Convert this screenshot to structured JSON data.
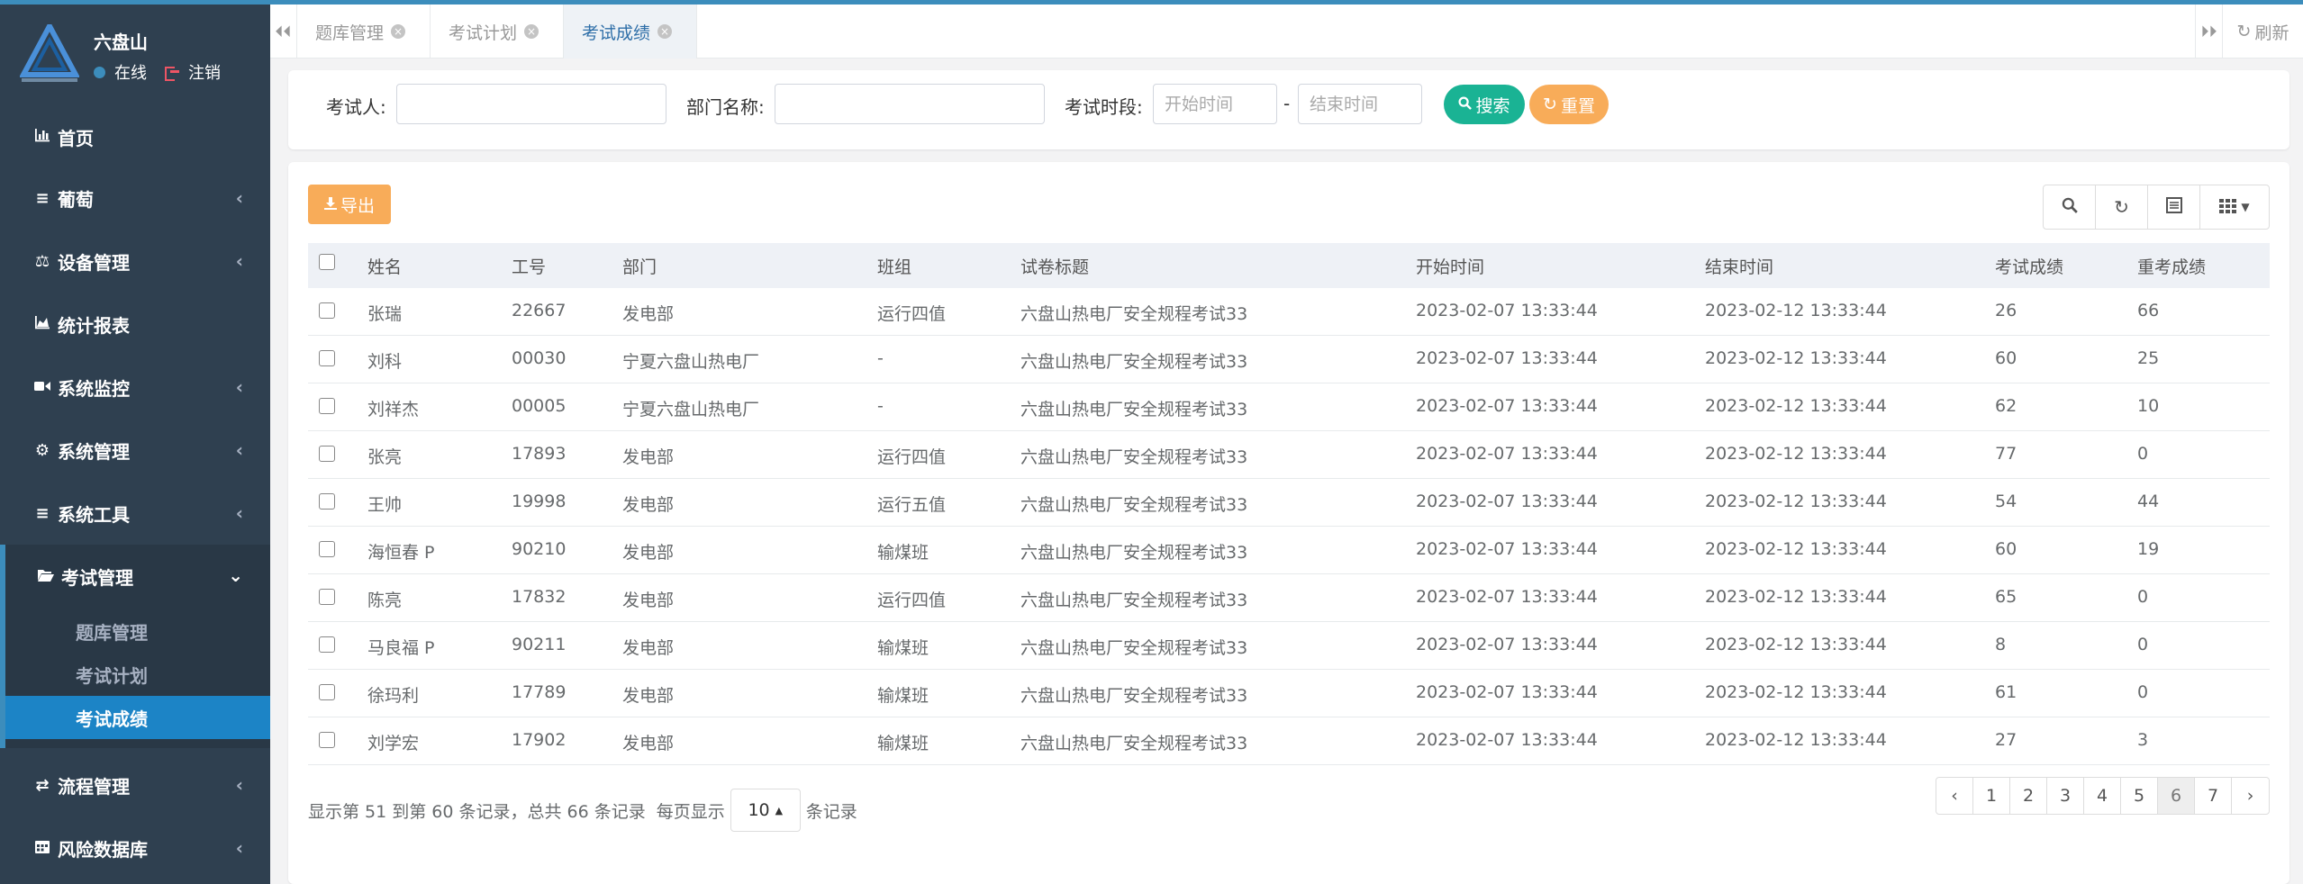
{
  "brand": {
    "user_name": "六盘山",
    "status": "在线",
    "logout": "注销"
  },
  "sidebar": {
    "items": [
      {
        "icon": "bar-chart-icon",
        "label": "首页"
      },
      {
        "icon": "list-icon",
        "label": "葡萄"
      },
      {
        "icon": "balance-icon",
        "label": "设备管理"
      },
      {
        "icon": "area-chart-icon",
        "label": "统计报表"
      },
      {
        "icon": "video-icon",
        "label": "系统监控"
      },
      {
        "icon": "gear-icon",
        "label": "系统管理"
      },
      {
        "icon": "list-icon",
        "label": "系统工具"
      },
      {
        "icon": "folder-open-icon",
        "label": "考试管理"
      },
      {
        "icon": "exchange-icon",
        "label": "流程管理"
      },
      {
        "icon": "calendar-icon",
        "label": "风险数据库"
      }
    ],
    "sub_items": [
      "题库管理",
      "考试计划",
      "考试成绩"
    ]
  },
  "tabs": [
    {
      "label": "题库管理"
    },
    {
      "label": "考试计划"
    },
    {
      "label": "考试成绩"
    }
  ],
  "tabsbar": {
    "refresh": "刷新"
  },
  "search": {
    "examinee_label": "考试人:",
    "dept_label": "部门名称:",
    "period_label": "考试时段:",
    "start_placeholder": "开始时间",
    "end_placeholder": "结束时间",
    "dash": "-",
    "search_btn": "搜索",
    "reset_btn": "重置"
  },
  "toolbar": {
    "export": "导出"
  },
  "table": {
    "headers": [
      "姓名",
      "工号",
      "部门",
      "班组",
      "试卷标题",
      "开始时间",
      "结束时间",
      "考试成绩",
      "重考成绩"
    ],
    "rows": [
      [
        "张瑞",
        "22667",
        "发电部",
        "运行四值",
        "六盘山热电厂安全规程考试33",
        "2023-02-07 13:33:44",
        "2023-02-12 13:33:44",
        "26",
        "66"
      ],
      [
        "刘科",
        "00030",
        "宁夏六盘山热电厂",
        "-",
        "六盘山热电厂安全规程考试33",
        "2023-02-07 13:33:44",
        "2023-02-12 13:33:44",
        "60",
        "25"
      ],
      [
        "刘祥杰",
        "00005",
        "宁夏六盘山热电厂",
        "-",
        "六盘山热电厂安全规程考试33",
        "2023-02-07 13:33:44",
        "2023-02-12 13:33:44",
        "62",
        "10"
      ],
      [
        "张亮",
        "17893",
        "发电部",
        "运行四值",
        "六盘山热电厂安全规程考试33",
        "2023-02-07 13:33:44",
        "2023-02-12 13:33:44",
        "77",
        "0"
      ],
      [
        "王帅",
        "19998",
        "发电部",
        "运行五值",
        "六盘山热电厂安全规程考试33",
        "2023-02-07 13:33:44",
        "2023-02-12 13:33:44",
        "54",
        "44"
      ],
      [
        "海恒春 P",
        "90210",
        "发电部",
        "输煤班",
        "六盘山热电厂安全规程考试33",
        "2023-02-07 13:33:44",
        "2023-02-12 13:33:44",
        "60",
        "19"
      ],
      [
        "陈亮",
        "17832",
        "发电部",
        "运行四值",
        "六盘山热电厂安全规程考试33",
        "2023-02-07 13:33:44",
        "2023-02-12 13:33:44",
        "65",
        "0"
      ],
      [
        "马良福 P",
        "90211",
        "发电部",
        "输煤班",
        "六盘山热电厂安全规程考试33",
        "2023-02-07 13:33:44",
        "2023-02-12 13:33:44",
        "8",
        "0"
      ],
      [
        "徐玛利",
        "17789",
        "发电部",
        "输煤班",
        "六盘山热电厂安全规程考试33",
        "2023-02-07 13:33:44",
        "2023-02-12 13:33:44",
        "61",
        "0"
      ],
      [
        "刘学宏",
        "17902",
        "发电部",
        "输煤班",
        "六盘山热电厂安全规程考试33",
        "2023-02-07 13:33:44",
        "2023-02-12 13:33:44",
        "27",
        "3"
      ]
    ]
  },
  "pager": {
    "summary": "显示第 51 到第 60 条记录，总共 66 条记录",
    "per_page_prefix": "每页显示",
    "page_size": "10",
    "per_page_suffix": "条记录",
    "prev": "‹",
    "next": "›",
    "pages": [
      "1",
      "2",
      "3",
      "4",
      "5",
      "6",
      "7"
    ],
    "current": "6"
  },
  "colors": {
    "sidebar_bg": "#2f4050",
    "accent": "#1c84c6",
    "search_btn": "#1ab394",
    "reset_btn": "#f8ac59"
  }
}
